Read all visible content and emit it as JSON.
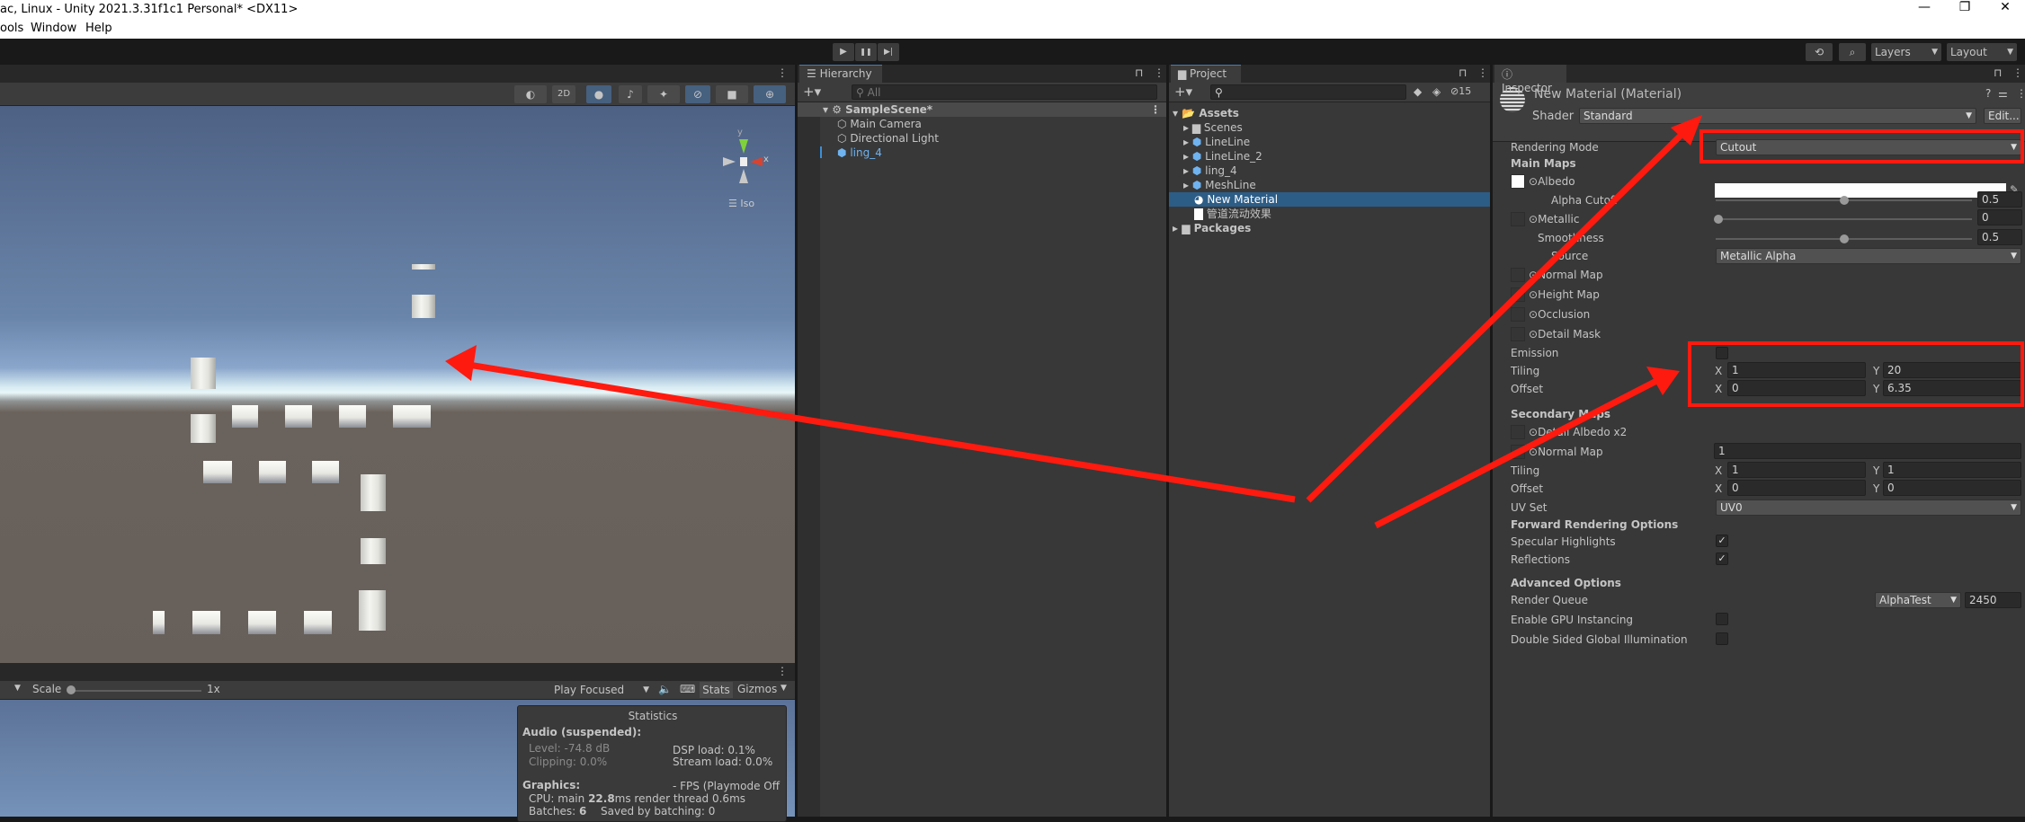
{
  "window": {
    "title": "ac, Linux - Unity 2021.3.31f1c1 Personal* <DX11>",
    "minimize": "—",
    "restore": "❐",
    "close": "✕"
  },
  "menu": [
    "ools",
    "Window",
    "Help"
  ],
  "toolbar": {
    "play": "▶",
    "pause": "❚❚",
    "step": "▶|",
    "history_icon": "history-icon",
    "search_icon": "search-icon",
    "layers": "Layers",
    "layout": "Layout"
  },
  "scene": {
    "buttons": {
      "shading": "◐",
      "mode_2d": "2D",
      "lighting": "lighting-icon",
      "audio": "audio-icon",
      "effects": "effects-icon",
      "hidden": "visibility-icon",
      "camera": "camera-icon",
      "gizmos": "gizmos-icon"
    },
    "gizmo": {
      "y": "y",
      "x": "x",
      "projection": "Iso"
    }
  },
  "game": {
    "scale_label": "Scale",
    "scale_value": "1x",
    "scale_fraction": 0,
    "play_mode": "Play Focused",
    "stats": "Stats",
    "gizmos": "Gizmos",
    "statistics": {
      "title": "Statistics",
      "audio_header": "Audio (suspended):",
      "level": "Level: -74.8 dB",
      "clipping": "Clipping: 0.0%",
      "dsp": "DSP load: 0.1%",
      "stream": "Stream load: 0.0%",
      "graphics_header": "Graphics:",
      "fps": "- FPS (Playmode Off",
      "cpu_prefix": "CPU: main ",
      "cpu_main": "22.8",
      "cpu_suffix": "ms  render thread 0.6ms",
      "batches_prefix": "Batches: ",
      "batches": "6",
      "saved": "Saved by batching: 0"
    }
  },
  "hierarchy": {
    "tab": "Hierarchy",
    "search_placeholder": "All",
    "scene": "SampleScene*",
    "items": [
      "Main Camera",
      "Directional Light",
      "ling_4"
    ]
  },
  "project": {
    "tab": "Project",
    "hidden_count": "15",
    "assets": "Assets",
    "items": [
      "Scenes",
      "LineLine",
      "LineLine_2",
      "ling_4",
      "MeshLine",
      "New Material",
      "管道流动效果"
    ],
    "selected": "New Material",
    "packages": "Packages"
  },
  "inspector": {
    "tab": "Inspector",
    "title": "New Material (Material)",
    "shader_label": "Shader",
    "shader": "Standard",
    "edit": "Edit...",
    "rendering_mode_label": "Rendering Mode",
    "rendering_mode": "Cutout",
    "main_maps": "Main Maps",
    "albedo": "Albedo",
    "albedo_color": "#ffffff",
    "alpha_cutoff": "Alpha Cutoff",
    "alpha_cutoff_value": "0.5",
    "metallic": "Metallic",
    "metallic_value": "0",
    "smoothness": "Smoothness",
    "smoothness_value": "0.5",
    "source": "Source",
    "source_value": "Metallic Alpha",
    "normal_map": "Normal Map",
    "height_map": "Height Map",
    "occlusion": "Occlusion",
    "detail_mask": "Detail Mask",
    "emission": "Emission",
    "tiling": "Tiling",
    "offset": "Offset",
    "x": "X",
    "y": "Y",
    "main_tiling": {
      "x": "1",
      "y": "20"
    },
    "main_offset": {
      "x": "0",
      "y": "6.35"
    },
    "secondary_maps": "Secondary Maps",
    "detail_albedo": "Detail Albedo x2",
    "detail_normal": "Normal Map",
    "detail_normal_scale": "1",
    "sec_tiling": {
      "x": "1",
      "y": "1"
    },
    "sec_offset": {
      "x": "0",
      "y": "0"
    },
    "uv_set_label": "UV Set",
    "uv_set": "UV0",
    "forward": "Forward Rendering Options",
    "specular": "Specular Highlights",
    "reflections": "Reflections",
    "advanced": "Advanced Options",
    "render_queue": "Render Queue",
    "render_queue_mode": "AlphaTest",
    "render_queue_value": "2450",
    "gpu_instancing": "Enable GPU Instancing",
    "double_sided_gi": "Double Sided Global Illumination"
  },
  "annotation_color": "#ff1a0f"
}
